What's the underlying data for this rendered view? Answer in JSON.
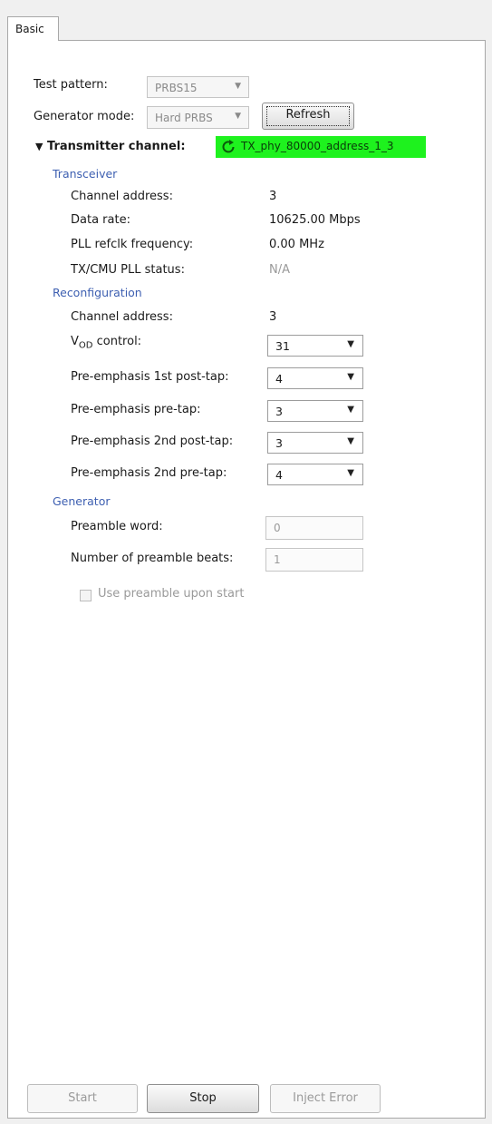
{
  "tab": {
    "label": "Basic"
  },
  "test_pattern": {
    "label": "Test pattern:",
    "value": "PRBS15"
  },
  "generator_mode": {
    "label": "Generator mode:",
    "value": "Hard PRBS"
  },
  "refresh_button": {
    "label": "Refresh"
  },
  "transmitter": {
    "header": "Transmitter channel:",
    "channel_name": "TX_phy_80000_address_1_3",
    "badge_color": "#1ef21e"
  },
  "transceiver": {
    "title": "Transceiver",
    "rows": [
      {
        "label": "Channel address:",
        "value": "3"
      },
      {
        "label": "Data rate:",
        "value": "10625.00 Mbps"
      },
      {
        "label": "PLL refclk frequency:",
        "value": "0.00 MHz"
      },
      {
        "label": "TX/CMU PLL status:",
        "value": "N/A"
      }
    ]
  },
  "reconfiguration": {
    "title": "Reconfiguration",
    "channel_address": {
      "label": "Channel address:",
      "value": "3"
    },
    "vod": {
      "label_main": "V",
      "label_sub": "OD",
      "label_rest": " control:",
      "value": "31"
    },
    "pre1": {
      "label": "Pre-emphasis 1st post-tap:",
      "value": "4"
    },
    "pre_pre": {
      "label": "Pre-emphasis pre-tap:",
      "value": "3"
    },
    "pre2_post": {
      "label": "Pre-emphasis 2nd post-tap:",
      "value": "3"
    },
    "pre2_pre": {
      "label": "Pre-emphasis 2nd pre-tap:",
      "value": "4"
    }
  },
  "generator": {
    "title": "Generator",
    "preamble_word": {
      "label": "Preamble word:",
      "value": "0"
    },
    "preamble_beats": {
      "label": "Number of preamble beats:",
      "value": "1"
    },
    "use_preamble": {
      "label": "Use preamble upon start"
    }
  },
  "footer": {
    "start": "Start",
    "stop": "Stop",
    "inject": "Inject Error"
  }
}
